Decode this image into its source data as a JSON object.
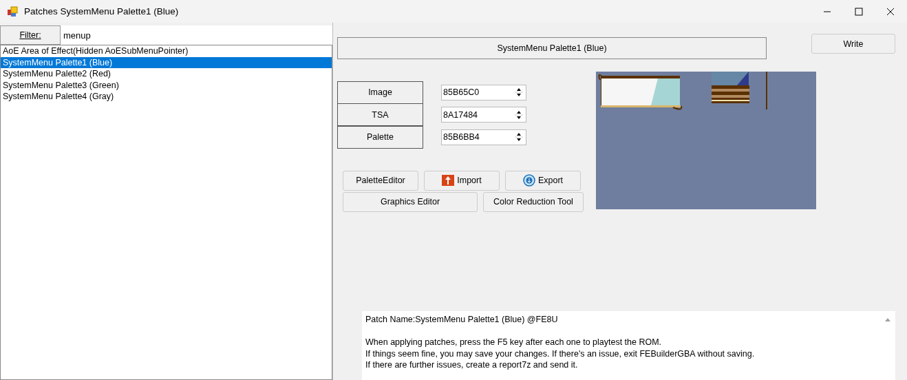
{
  "window": {
    "title": "Patches SystemMenu Palette1 (Blue)"
  },
  "filter": {
    "label": "Filter:",
    "value": "menup"
  },
  "list": [
    {
      "label": "AoE Area of Effect(Hidden AoESubMenuPointer)",
      "selected": false
    },
    {
      "label": "SystemMenu Palette1 (Blue)",
      "selected": true
    },
    {
      "label": "SystemMenu Palette2 (Red)",
      "selected": false
    },
    {
      "label": "SystemMenu Palette3 (Green)",
      "selected": false
    },
    {
      "label": "SystemMenu Palette4 (Gray)",
      "selected": false
    }
  ],
  "patch_title": "SystemMenu Palette1 (Blue)",
  "write_button": "Write",
  "fields": [
    {
      "label": "Image",
      "value": "85B65C0"
    },
    {
      "label": "TSA",
      "value": "8A17484"
    },
    {
      "label": "Palette",
      "value": "85B6BB4"
    }
  ],
  "buttons": [
    {
      "label": "PaletteEditor",
      "kind": "plain"
    },
    {
      "label": "Import",
      "kind": "import"
    },
    {
      "label": "Export",
      "kind": "export"
    }
  ],
  "buttons_row2": [
    "Graphics Editor",
    "Color Reduction Tool"
  ],
  "preview": {
    "kind": "picture"
  },
  "description": {
    "header": "Patch Name:SystemMenu Palette1 (Blue)  @FE8U",
    "lines": [
      "When applying patches, press the F5 key after each one to playtest the ROM.",
      "If things seem fine, you may save your changes. If there's an issue, exit FEBuilderGBA without saving.",
      "If there are further issues, create a report7z and send it."
    ]
  }
}
